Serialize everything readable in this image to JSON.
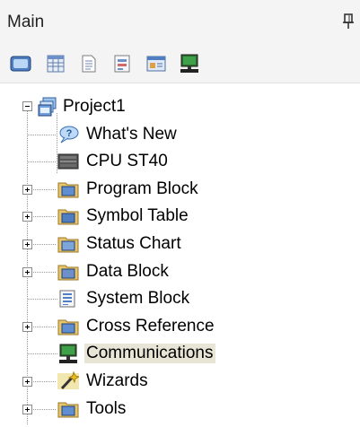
{
  "panel": {
    "title": "Main"
  },
  "toolbar": {
    "buttons": [
      "symbol-table",
      "status-chart",
      "data-block",
      "system-block",
      "cross-reference",
      "communications"
    ]
  },
  "tree": {
    "root": "Project1",
    "items": [
      {
        "label": "What's New",
        "icon": "help-bubble-icon",
        "expandable": false
      },
      {
        "label": "CPU ST40",
        "icon": "cpu-module-icon",
        "expandable": false
      },
      {
        "label": "Program Block",
        "icon": "program-block-folder-icon",
        "expandable": true
      },
      {
        "label": "Symbol Table",
        "icon": "symbol-table-folder-icon",
        "expandable": true
      },
      {
        "label": "Status Chart",
        "icon": "status-chart-folder-icon",
        "expandable": true
      },
      {
        "label": "Data Block",
        "icon": "data-block-folder-icon",
        "expandable": true
      },
      {
        "label": "System Block",
        "icon": "system-block-icon",
        "expandable": false
      },
      {
        "label": "Cross Reference",
        "icon": "cross-reference-folder-icon",
        "expandable": true
      },
      {
        "label": "Communications",
        "icon": "communications-icon",
        "expandable": false,
        "selected": true
      },
      {
        "label": "Wizards",
        "icon": "wizard-wand-icon",
        "expandable": true
      },
      {
        "label": "Tools",
        "icon": "tools-folder-icon",
        "expandable": true
      }
    ]
  }
}
